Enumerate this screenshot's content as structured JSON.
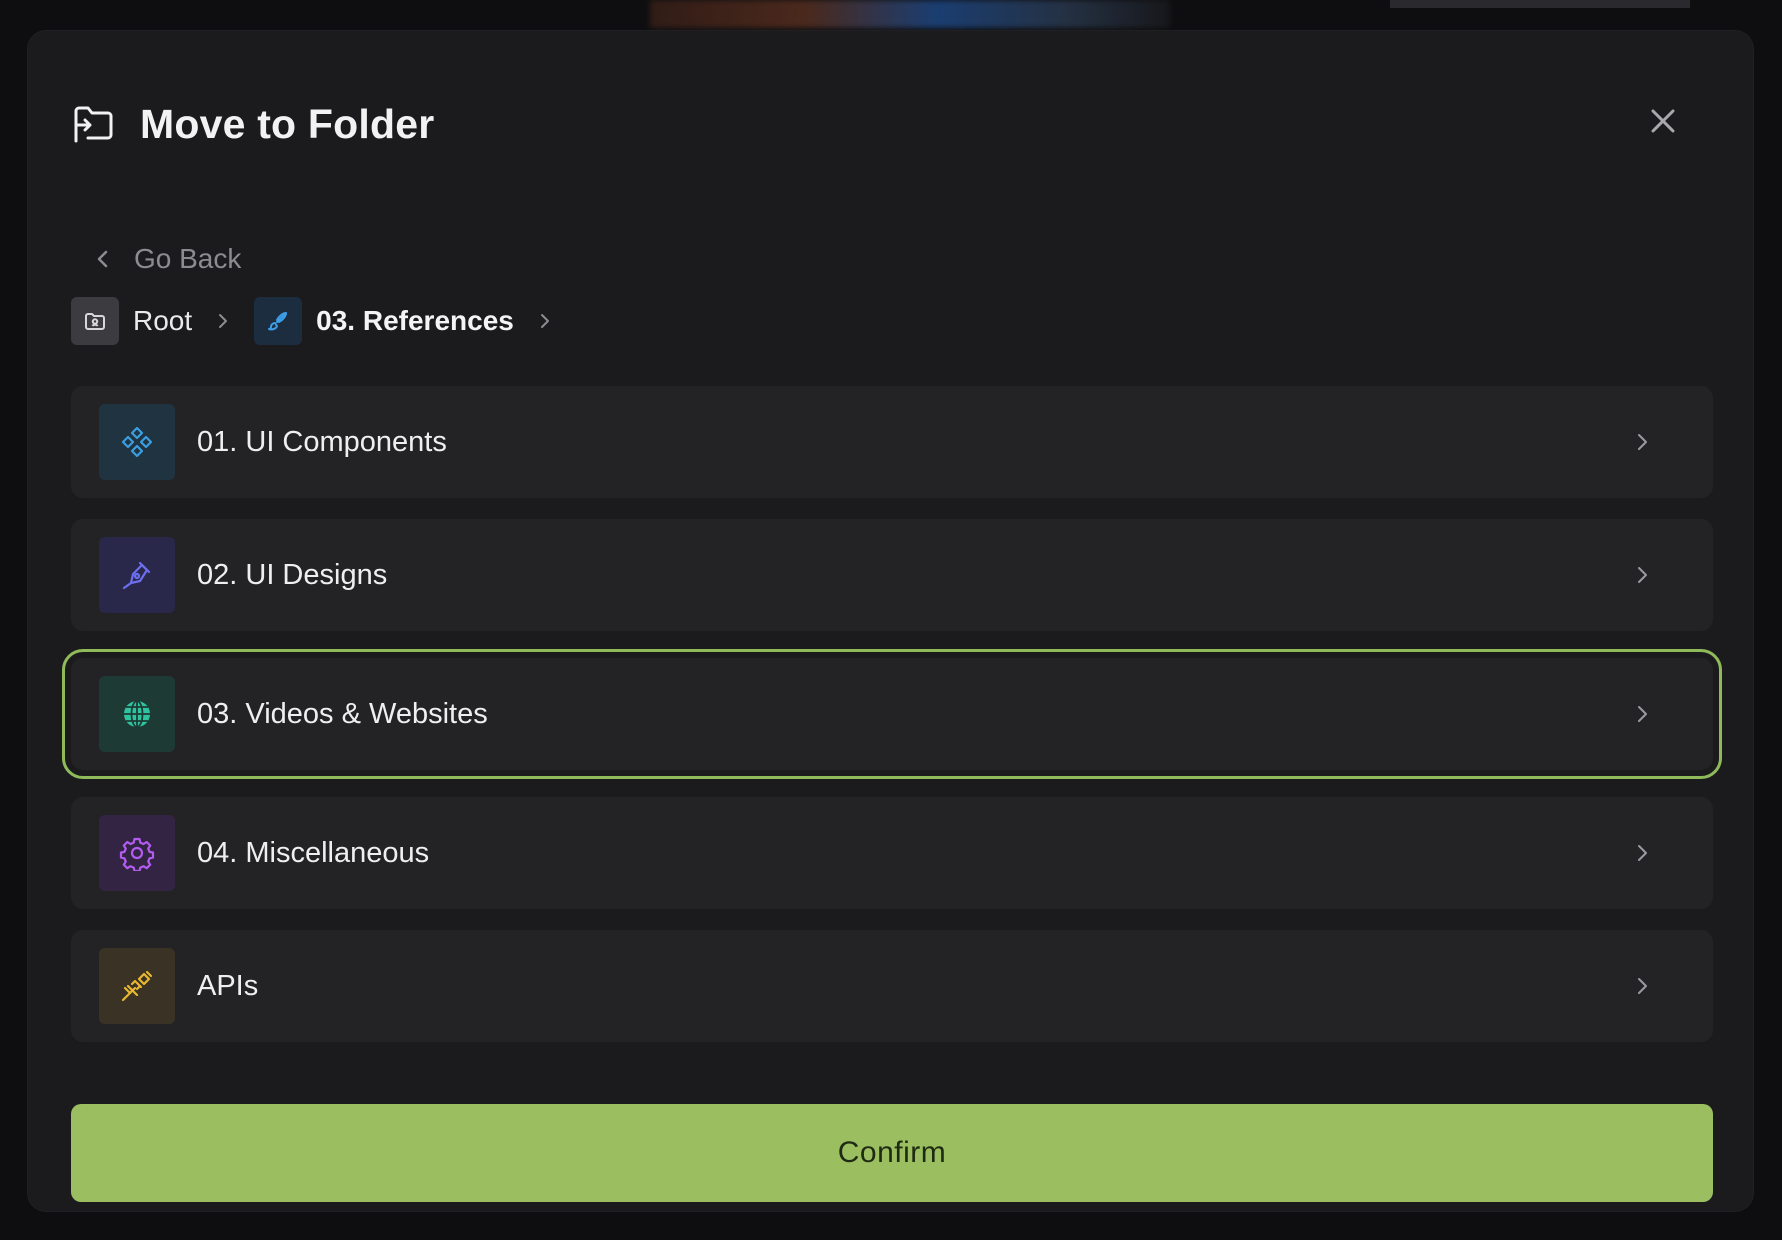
{
  "dialog": {
    "title": "Move to Folder",
    "go_back_label": "Go Back",
    "confirm_label": "Confirm"
  },
  "breadcrumb": {
    "root_label": "Root",
    "current_label": "03. References"
  },
  "folders": [
    {
      "label": "01. UI Components",
      "icon": "components-icon",
      "color": "#3b9ee0",
      "selected": false
    },
    {
      "label": "02. UI Designs",
      "icon": "pen-tool-icon",
      "color": "#6c6ef0",
      "selected": false
    },
    {
      "label": "03. Videos & Websites",
      "icon": "globe-icon",
      "color": "#2ec4a0",
      "selected": true
    },
    {
      "label": "04. Miscellaneous",
      "icon": "gear-icon",
      "color": "#b25cf0",
      "selected": false
    },
    {
      "label": "APIs",
      "icon": "plug-icon",
      "color": "#e8b830",
      "selected": false
    }
  ],
  "colors": {
    "accent": "#9bbf60",
    "selected_outline": "#8fba5a",
    "modal_bg": "#1b1b1e",
    "row_bg": "#232326"
  }
}
